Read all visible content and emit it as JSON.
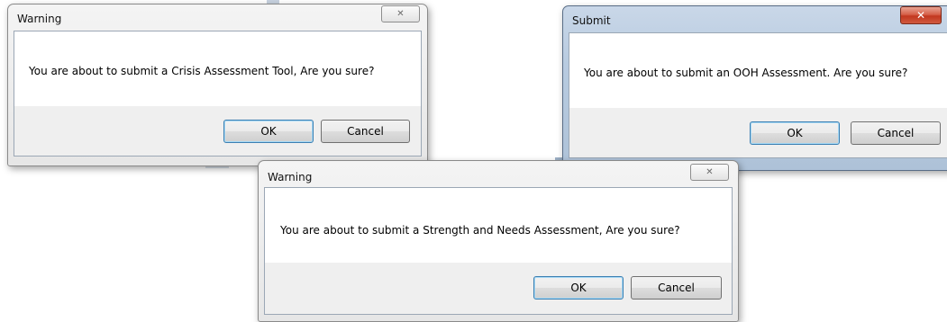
{
  "dialogs": {
    "warning_crisis": {
      "title": "Warning",
      "close_glyph": "✕",
      "message": "You are about to submit a Crisis Assessment Tool, Are you sure?",
      "ok_label": "OK",
      "cancel_label": "Cancel"
    },
    "submit_ooh": {
      "title": "Submit",
      "close_glyph": "✕",
      "message": "You are about to submit an OOH Assessment. Are you sure?",
      "ok_label": "OK",
      "cancel_label": "Cancel"
    },
    "warning_strength": {
      "title": "Warning",
      "close_glyph": "✕",
      "message": "You are about to submit a Strength and Needs Assessment, Are you sure?",
      "ok_label": "OK",
      "cancel_label": "Cancel"
    }
  },
  "icons": {
    "close": "close-icon"
  },
  "colors": {
    "close_button_red": "#c2371f",
    "default_button_border": "#3c7fb1",
    "button_area_bg": "#efefef"
  }
}
